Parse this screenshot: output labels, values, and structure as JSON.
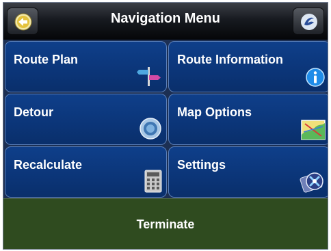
{
  "header": {
    "title": "Navigation Menu",
    "back_icon": "back-arrow-icon",
    "logo_icon": "app-logo-icon"
  },
  "menu": {
    "route_plan": {
      "label": "Route Plan",
      "icon": "signpost-icon"
    },
    "route_information": {
      "label": "Route Information",
      "icon": "info-icon"
    },
    "detour": {
      "label": "Detour",
      "icon": "detour-icon"
    },
    "map_options": {
      "label": "Map Options",
      "icon": "map-icon"
    },
    "recalculate": {
      "label": "Recalculate",
      "icon": "calculator-icon"
    },
    "settings": {
      "label": "Settings",
      "icon": "settings-icon"
    }
  },
  "terminate": {
    "label": "Terminate"
  },
  "colors": {
    "tile_blue": "#0b3578",
    "terminate_green": "#2f4b1f",
    "header_dark": "#171a20"
  }
}
